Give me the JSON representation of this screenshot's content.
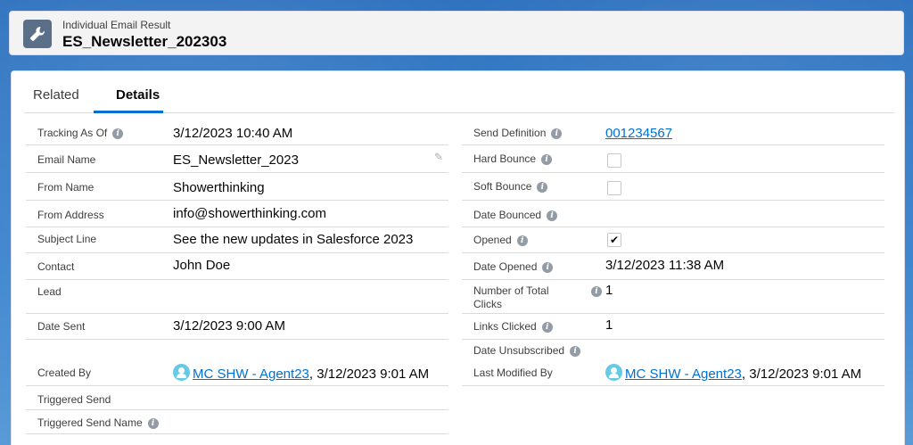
{
  "header": {
    "eyebrow": "Individual Email Result",
    "title": "ES_Newsletter_202303",
    "icon": "wrench-icon"
  },
  "tabs": [
    {
      "label": "Related",
      "active": false
    },
    {
      "label": "Details",
      "active": true
    }
  ],
  "left_fields": {
    "tracking_as_of": {
      "label": "Tracking As Of",
      "value": "3/12/2023 10:40 AM"
    },
    "email_name": {
      "label": "Email Name",
      "value": "ES_Newsletter_2023"
    },
    "from_name": {
      "label": "From Name",
      "value": "Showerthinking"
    },
    "from_address": {
      "label": "From Address",
      "value": "info@showerthinking.com"
    },
    "subject_line": {
      "label": "Subject Line",
      "value": "See the new updates in Salesforce 2023"
    },
    "contact": {
      "label": "Contact",
      "value": "John Doe"
    },
    "lead": {
      "label": "Lead",
      "value": ""
    },
    "date_sent": {
      "label": "Date Sent",
      "value": "3/12/2023 9:00 AM"
    },
    "created_by": {
      "label": "Created By",
      "user": "MC SHW - Agent23",
      "date": ", 3/12/2023 9:01 AM"
    },
    "triggered_send": {
      "label": "Triggered Send",
      "value": ""
    },
    "triggered_send_name": {
      "label": "Triggered Send Name",
      "value": ""
    }
  },
  "right_fields": {
    "send_definition": {
      "label": "Send Definition",
      "value": "001234567"
    },
    "hard_bounce": {
      "label": "Hard Bounce",
      "checked": false
    },
    "soft_bounce": {
      "label": "Soft Bounce",
      "checked": false
    },
    "date_bounced": {
      "label": "Date Bounced",
      "value": ""
    },
    "opened": {
      "label": "Opened",
      "checked": true,
      "mark": "✔"
    },
    "date_opened": {
      "label": "Date Opened",
      "value": "3/12/2023 11:38 AM"
    },
    "total_clicks": {
      "label_line1": "Number of Total",
      "label_line2": "Clicks",
      "value": "1"
    },
    "links_clicked": {
      "label": "Links Clicked",
      "value": "1"
    },
    "date_unsubscribed": {
      "label": "Date Unsubscribed",
      "value": ""
    },
    "last_modified_by": {
      "label": "Last Modified By",
      "user": "MC SHW - Agent23",
      "date": ", 3/12/2023 9:01 AM"
    }
  },
  "info_glyph": "i",
  "pencil_glyph": "✎",
  "colors": {
    "link": "#0070d2",
    "tab_active": "#0070d2",
    "header_icon": "#5b6f89",
    "avatar": "#65cae4"
  }
}
